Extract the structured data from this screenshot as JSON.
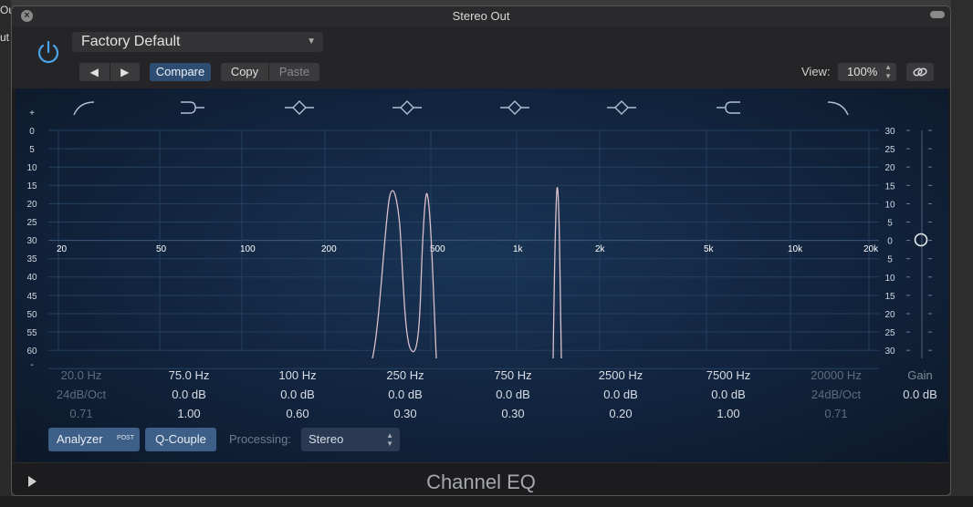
{
  "window": {
    "title": "Stereo Out"
  },
  "background": {
    "left_text_1": "Ou",
    "left_text_2": "ut"
  },
  "header": {
    "preset": "Factory Default",
    "nav_prev": "◀",
    "nav_next": "▶",
    "compare": "Compare",
    "copy": "Copy",
    "paste": "Paste",
    "view_label": "View:",
    "view_value": "100%"
  },
  "graph": {
    "left_db_labels": [
      "+",
      "0",
      "5",
      "10",
      "15",
      "20",
      "25",
      "30",
      "35",
      "40",
      "45",
      "50",
      "55",
      "60",
      "-"
    ],
    "right_db_labels": [
      "30",
      "25",
      "20",
      "15",
      "10",
      "5",
      "0",
      "5",
      "10",
      "15",
      "20",
      "25",
      "30"
    ],
    "freq_labels": [
      "20",
      "50",
      "100",
      "200",
      "500",
      "1k",
      "2k",
      "5k",
      "10k",
      "20k"
    ],
    "accent_color": "#aebfd4",
    "curve_color": "#d9c0cc"
  },
  "bands": [
    {
      "freq": "20.0 Hz",
      "gain": "24dB/Oct",
      "q": "0.71",
      "enabled": false
    },
    {
      "freq": "75.0 Hz",
      "gain": "0.0 dB",
      "q": "1.00",
      "enabled": true
    },
    {
      "freq": "100 Hz",
      "gain": "0.0 dB",
      "q": "0.60",
      "enabled": true
    },
    {
      "freq": "250 Hz",
      "gain": "0.0 dB",
      "q": "0.30",
      "enabled": true
    },
    {
      "freq": "750 Hz",
      "gain": "0.0 dB",
      "q": "0.30",
      "enabled": true
    },
    {
      "freq": "2500 Hz",
      "gain": "0.0 dB",
      "q": "0.20",
      "enabled": true
    },
    {
      "freq": "7500 Hz",
      "gain": "0.0 dB",
      "q": "1.00",
      "enabled": true
    },
    {
      "freq": "20000 Hz",
      "gain": "24dB/Oct",
      "q": "0.71",
      "enabled": false
    }
  ],
  "gain": {
    "label": "Gain",
    "value": "0.0 dB"
  },
  "controls": {
    "analyzer": "Analyzer",
    "analyzer_badge": "POST",
    "q_couple": "Q-Couple",
    "processing_label": "Processing:",
    "processing_value": "Stereo"
  },
  "footer": {
    "title": "Channel EQ"
  }
}
